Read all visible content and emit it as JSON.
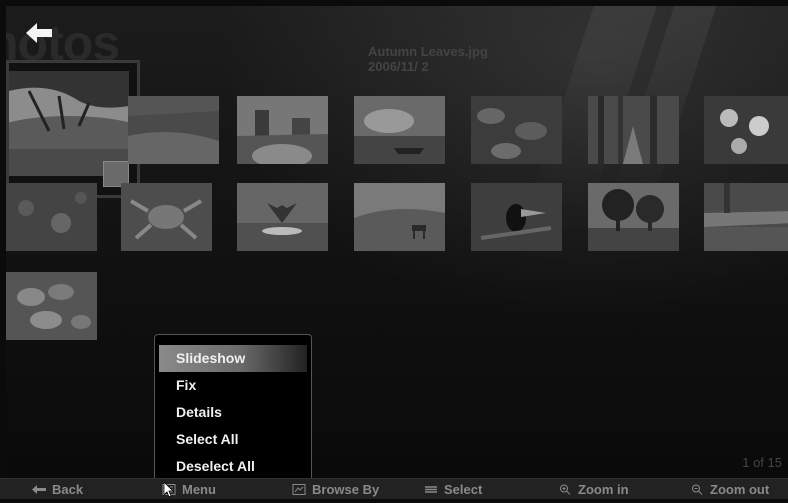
{
  "page": {
    "title": "hotos",
    "file_name": "Autumn Leaves.jpg",
    "file_date": "2006/11/ 2",
    "counter": "1 of 15"
  },
  "icons": {
    "back": "back-arrow-icon",
    "cursor": "mouse-cursor-icon"
  },
  "thumbnails": [
    {
      "subject": "tree-meadow",
      "selected": true
    },
    {
      "subject": "meadow-river"
    },
    {
      "subject": "desert-buttes"
    },
    {
      "subject": "lake-boat"
    },
    {
      "subject": "green-leaves"
    },
    {
      "subject": "forest-path"
    },
    {
      "subject": "flowers"
    },
    {
      "subject": "tree-bark"
    },
    {
      "subject": "sea-turtle"
    },
    {
      "subject": "whale-tail"
    },
    {
      "subject": "desert-dunes-oryx"
    },
    {
      "subject": "toucan"
    },
    {
      "subject": "trees-field"
    },
    {
      "subject": "waterfall-stream"
    },
    {
      "subject": "leaf-macro"
    }
  ],
  "context_menu": {
    "items": [
      "Slideshow",
      "Fix",
      "Details",
      "Select All",
      "Deselect All"
    ],
    "selected_index": 0
  },
  "bottom_bar": {
    "back": "Back",
    "menu": "Menu",
    "browse_by": "Browse By",
    "select": "Select",
    "zoom_in": "Zoom in",
    "zoom_out": "Zoom out"
  }
}
